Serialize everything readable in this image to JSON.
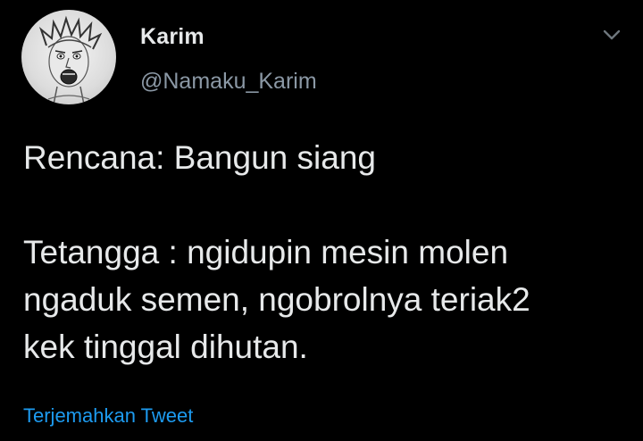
{
  "colors": {
    "background": "#000000",
    "text_primary": "#e7e9ea",
    "text_secondary": "#8b98a5",
    "link": "#1d9bf0"
  },
  "tweet": {
    "author": {
      "display_name": "Karim",
      "handle": "@Namaku_Karim",
      "avatar_icon": "avatar-sketch-portrait"
    },
    "menu_icon": "chevron-down-icon",
    "text_line_1": "Rencana: Bangun siang",
    "text_paragraph_2": "Tetangga : ngidupin mesin molen\nngaduk semen, ngobrolnya teriak2\nkek tinggal dihutan.",
    "translate_label": "Terjemahkan Tweet"
  }
}
